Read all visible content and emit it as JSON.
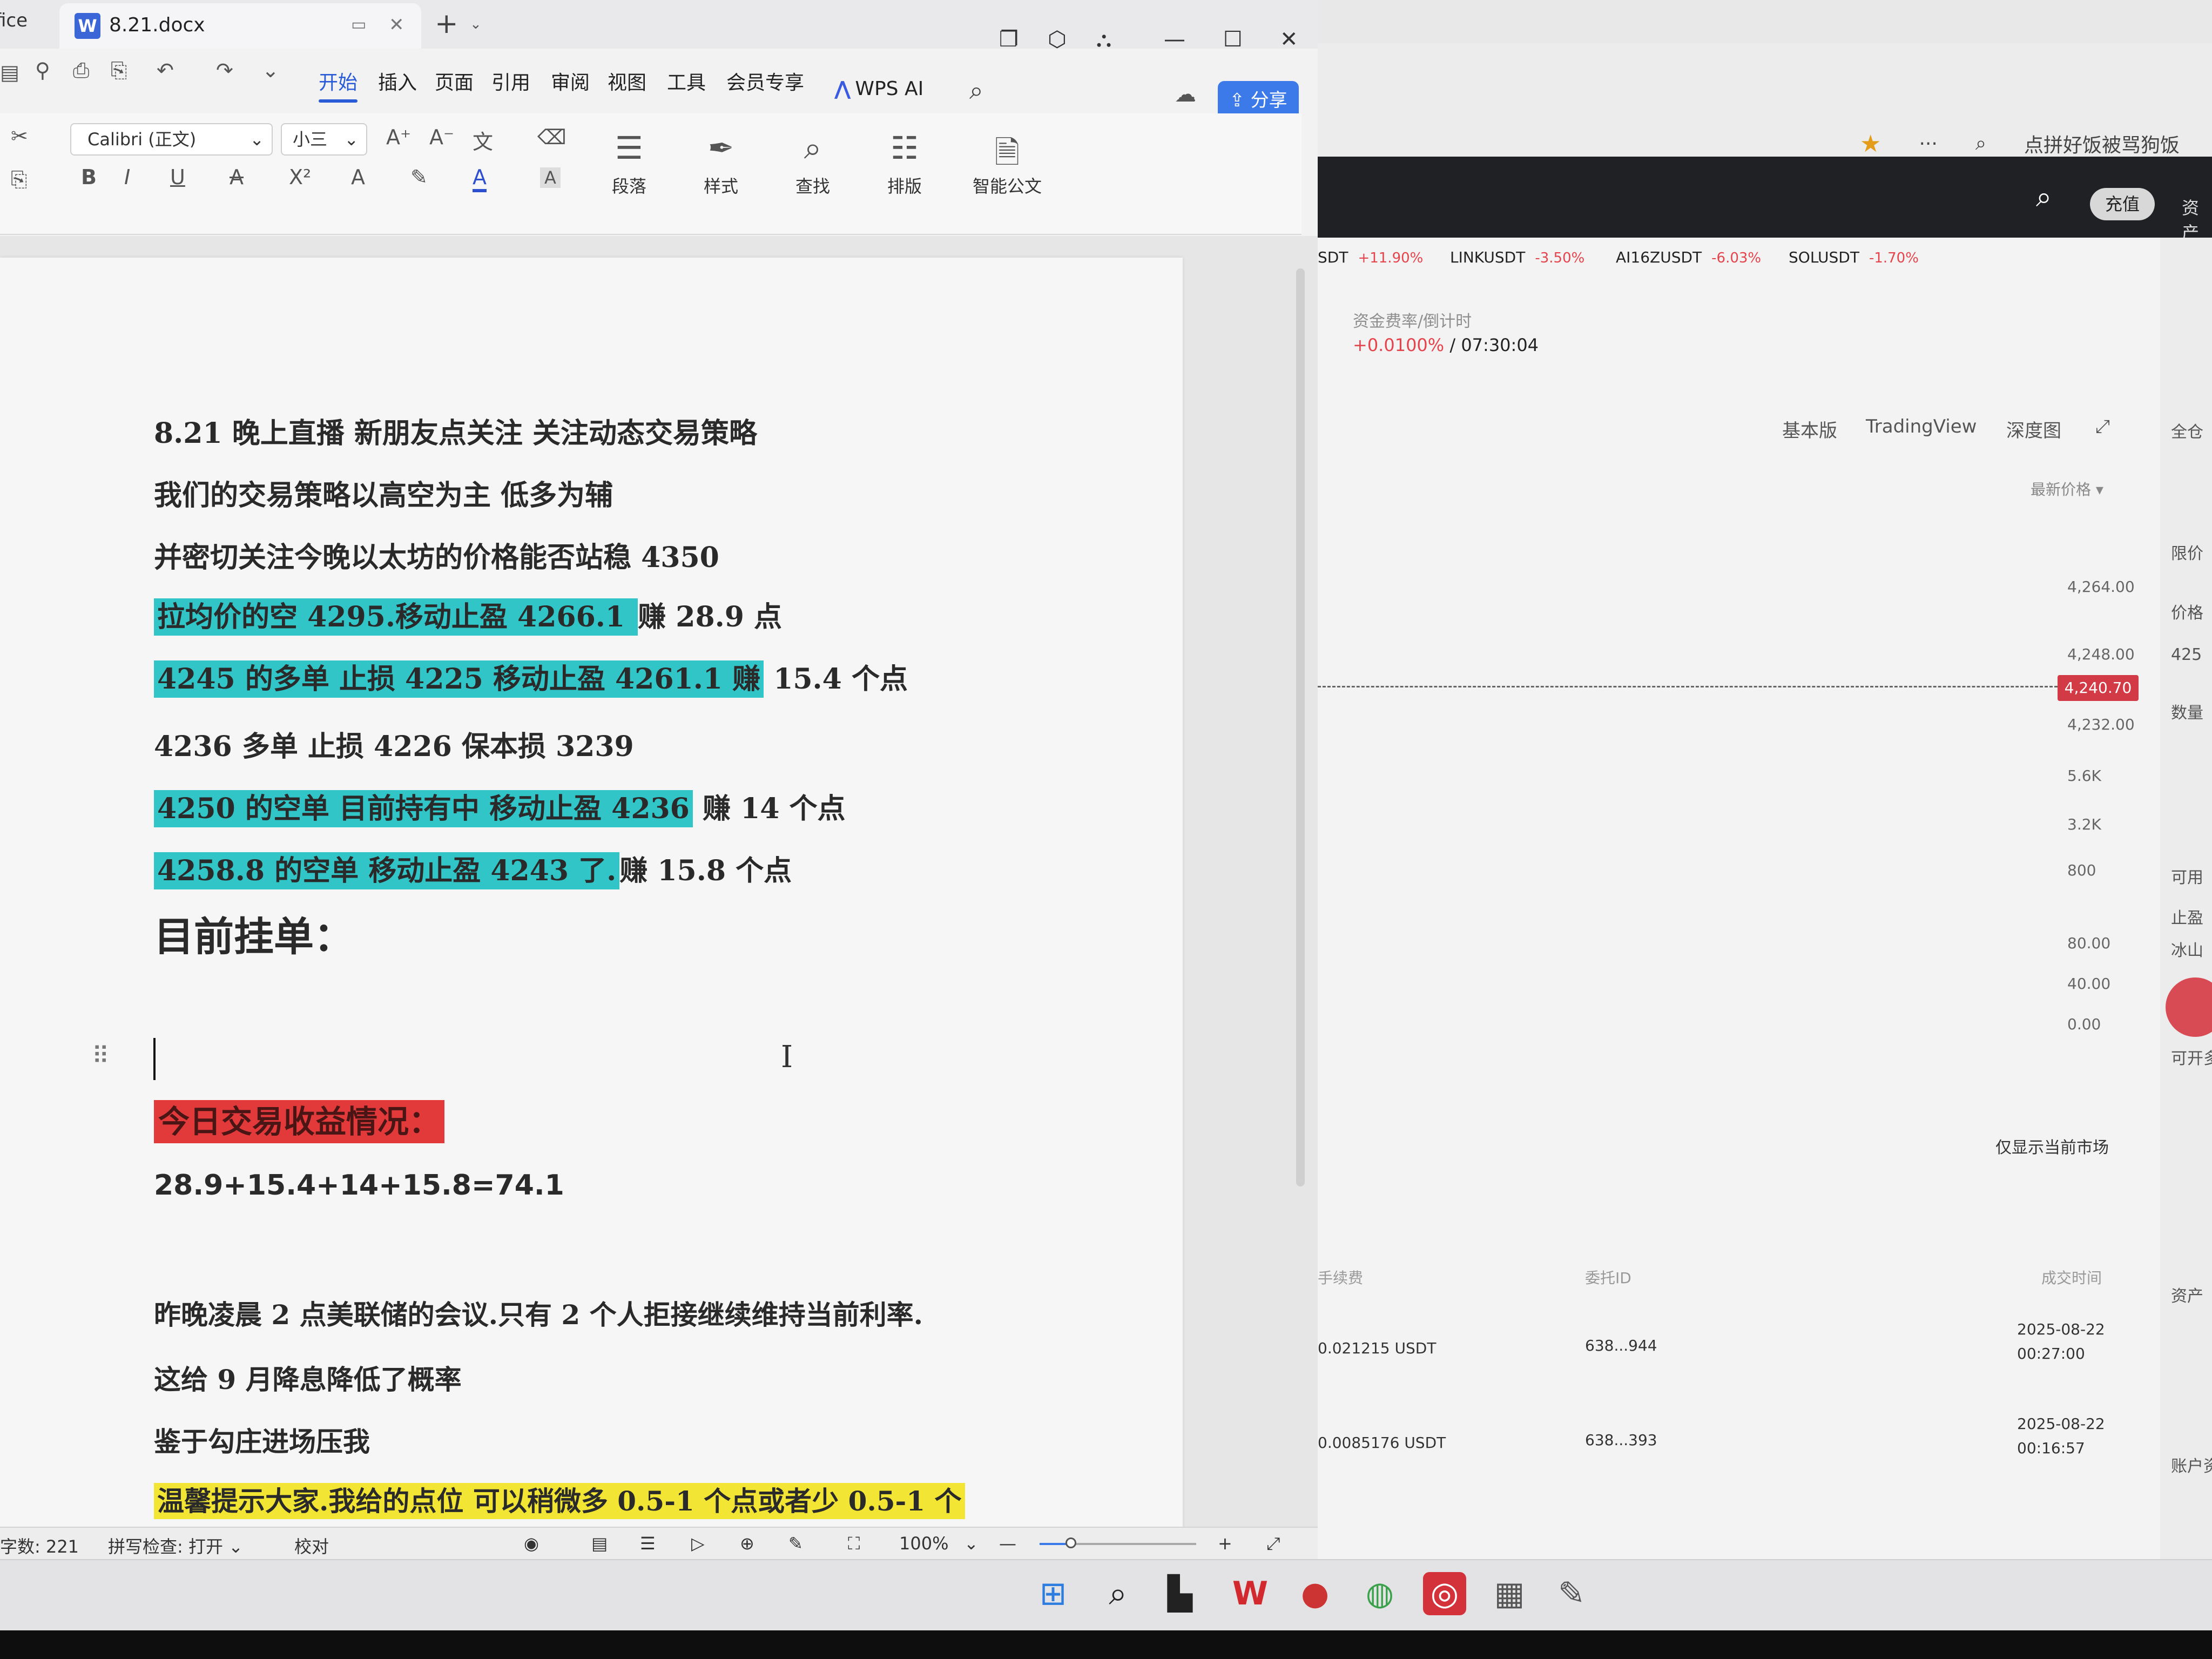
{
  "taskbar_app_label": "fice",
  "document_tab": {
    "badge": "W",
    "name": "8.21.docx"
  },
  "window_controls": {
    "restore": "❐",
    "minimize": "—",
    "maximize": "☐",
    "close": "✕"
  },
  "menu": {
    "items": [
      "开始",
      "插入",
      "页面",
      "引用",
      "审阅",
      "视图",
      "工具",
      "会员专享"
    ],
    "active_index": 0,
    "wps_ai": "WPS AI",
    "share": "分享"
  },
  "toolbar": {
    "font_name": "Calibri (正文)",
    "font_size": "小三",
    "format_icons": [
      "B",
      "I",
      "U",
      "A",
      "X²",
      "A",
      "A"
    ],
    "big_buttons": [
      {
        "label": "段落",
        "icon": "paragraph-icon"
      },
      {
        "label": "样式",
        "icon": "style-brush-icon"
      },
      {
        "label": "查找",
        "icon": "search-icon"
      },
      {
        "label": "排版",
        "icon": "layout-icon"
      },
      {
        "label": "智能公文",
        "icon": "smart-document-icon"
      }
    ]
  },
  "document": {
    "lines": [
      {
        "text": "8.21 晚上直播   新朋友点关注   关注动态交易策略",
        "highlight": "none"
      },
      {
        "text": "我们的交易策略以高空为主   低多为辅",
        "highlight": "none"
      },
      {
        "text": "并密切关注今晚以太坊的价格能否站稳 4350",
        "highlight": "none"
      },
      {
        "hl_text": "拉均价的空 4295.移动止盈 4266.1 ",
        "rest": " 赚 28.9 点",
        "highlight": "cyan"
      },
      {
        "hl_text": "4245 的多单   止损 4225   移动止盈 4261.1 赚",
        "rest": " 15.4 个点",
        "highlight": "cyan"
      },
      {
        "text": "4236 多单   止损 4226   保本损 3239",
        "highlight": "none"
      },
      {
        "hl_text": "4250 的空单  目前持有中  移动止盈 4236",
        "rest": " 赚 14 个点",
        "highlight": "cyan"
      },
      {
        "hl_text": "4258.8 的空单  移动止盈 4243 了.",
        "rest": "赚 15.8 个点",
        "highlight": "cyan"
      }
    ],
    "heading": "目前挂单：",
    "profit_heading": "今日交易收益情况：",
    "profit_formula": "28.9+15.4+14+15.8=74.1",
    "notes": [
      "昨晚凌晨 2 点美联储的会议.只有 2 个人拒接继续维持当前利率.",
      "这给 9 月降息降低了概率",
      "鉴于勾庄进场压我"
    ],
    "tip": "温馨提示大家.我给的点位  可以稍微多 0.5-1 个点或者少 0.5-1 个"
  },
  "statusbar": {
    "word_count": "字数: 221",
    "spell_check": "拼写检查: 打开 ⌄",
    "proofread": "校对",
    "zoom": "100%",
    "zoom_fraction": 0.2
  },
  "trading": {
    "search_placeholder": "点拼好饭被骂狗饭",
    "recharge": "充值",
    "assets": "资产",
    "tickers": [
      {
        "symbol": "SDT",
        "change": "+11.90%"
      },
      {
        "symbol": "LINKUSDT",
        "change": "-3.50%"
      },
      {
        "symbol": "AI16ZUSDT",
        "change": "-6.03%"
      },
      {
        "symbol": "SOLUSDT",
        "change": "-1.70%"
      }
    ],
    "funding_label": "资金费率/倒计时",
    "funding_rate": "+0.0100%",
    "countdown": "/ 07:30:04",
    "views": [
      "基本版",
      "TradingView",
      "深度图"
    ],
    "full_position": "全仓",
    "latest_price_label": "最新价格 ▾",
    "price_axis": [
      "4,264.00",
      "4,248.00",
      "4,232.00",
      "5.6K",
      "3.2K",
      "800",
      "80.00",
      "40.00",
      "0.00"
    ],
    "current_price": "4,240.70",
    "side_labels": [
      "限价",
      "价格",
      "425",
      "数量",
      "可用",
      "止盈",
      "冰山",
      "可开多"
    ],
    "only_current_market": "仅显示当前市场",
    "table_headers": [
      "手续费",
      "委托ID",
      "成交时间"
    ],
    "rows": [
      {
        "fee": "0.021215 USDT",
        "id": "638...944",
        "date": "2025-08-22",
        "time": "00:27:00"
      },
      {
        "fee": "0.0085176 USDT",
        "id": "638...393",
        "date": "2025-08-22",
        "time": "00:16:57"
      }
    ],
    "side_assets": "资产",
    "account_label": "账户资"
  },
  "taskbar": {
    "icons": [
      "windows-start-icon",
      "search-icon",
      "file-explorer-icon",
      "wps-icon",
      "app-icon",
      "chrome-icon",
      "netease-music-icon",
      "calculator-icon",
      "tool-icon"
    ]
  }
}
